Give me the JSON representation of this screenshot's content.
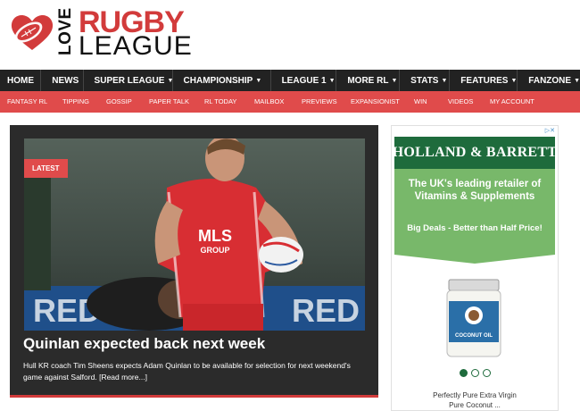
{
  "logo": {
    "love": "LOVE",
    "rugby": "RUGBY",
    "league": "LEAGUE"
  },
  "main_nav": [
    {
      "label": "HOME",
      "dropdown": false
    },
    {
      "label": "NEWS",
      "dropdown": false
    },
    {
      "label": "SUPER LEAGUE",
      "dropdown": true
    },
    {
      "label": "CHAMPIONSHIP",
      "dropdown": true
    },
    {
      "label": "LEAGUE 1",
      "dropdown": true
    },
    {
      "label": "MORE RL",
      "dropdown": true
    },
    {
      "label": "STATS",
      "dropdown": true
    },
    {
      "label": "FEATURES",
      "dropdown": true
    },
    {
      "label": "FANZONE",
      "dropdown": true
    }
  ],
  "sub_nav": [
    "FANTASY RL",
    "TIPPING",
    "GOSSIP",
    "PAPER TALK",
    "RL TODAY",
    "MAILBOX",
    "PREVIEWS",
    "EXPANSIONIST",
    "WIN",
    "VIDEOS",
    "MY ACCOUNT"
  ],
  "feature": {
    "badge": "LATEST",
    "headline": "Quinlan expected back next week",
    "excerpt": "Hull KR coach Tim Sheens expects Adam Quinlan to be available for selection for next weekend's game against Salford.",
    "read_more": "[Read more...]",
    "shirt_sponsor": "MLS GROUP"
  },
  "ad": {
    "brand": "HOLLAND & BARRETT",
    "tagline": "The UK's leading retailer of Vitamins & Supplements",
    "offer": "Big Deals - Better than Half Price!",
    "jar_label": "COCONUT OIL",
    "product": "Perfectly Pure Extra Virgin Pure Coconut ...",
    "carousel_active": 1,
    "colors": {
      "brand_green": "#1e6b3c",
      "light_green": "#78b86a"
    }
  },
  "colors": {
    "accent_red": "#e04b4b",
    "nav_dark": "#222222",
    "feature_bg": "#2b2b2b"
  }
}
